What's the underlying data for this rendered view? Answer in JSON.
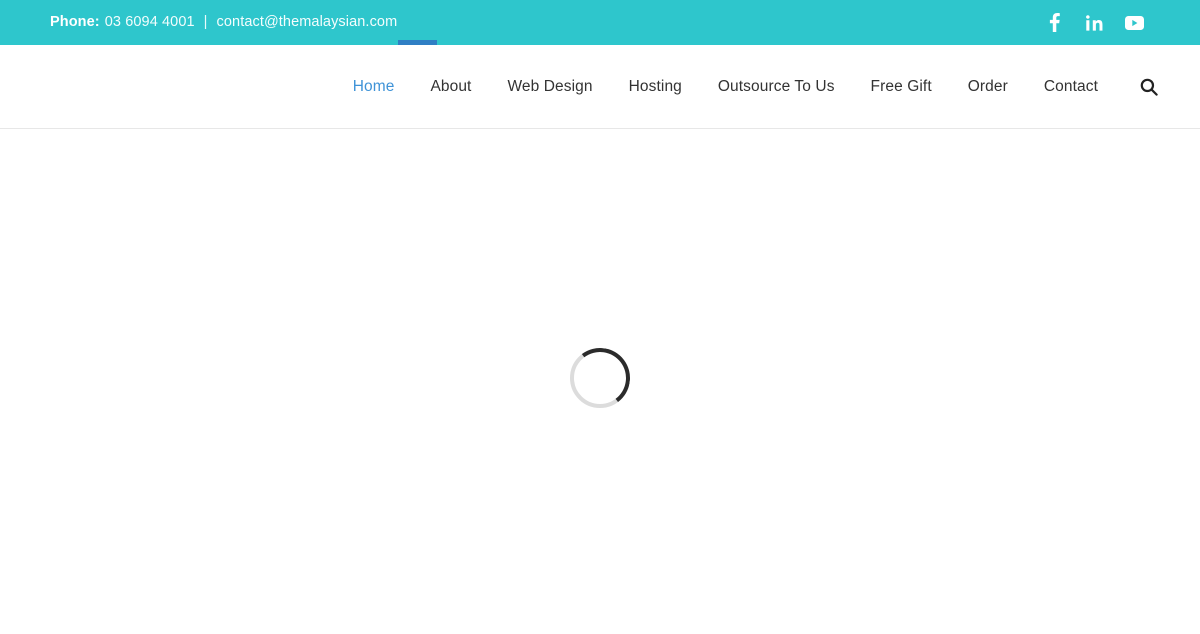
{
  "topbar": {
    "phone_label": "Phone:",
    "phone_number": "03 6094 4001",
    "separator": "|",
    "email": "contact@themalaysian.com",
    "background_color": "#2ec6cc",
    "social": [
      {
        "name": "facebook",
        "icon": "facebook-icon",
        "label": "Facebook"
      },
      {
        "name": "linkedin",
        "icon": "linkedin-icon",
        "label": "LinkedIn"
      },
      {
        "name": "youtube",
        "icon": "youtube-icon",
        "label": "YouTube"
      }
    ]
  },
  "nav": {
    "active_color": "#3f93d7",
    "text_color": "#333333",
    "items": [
      {
        "label": "Home",
        "active": true
      },
      {
        "label": "About",
        "active": false
      },
      {
        "label": "Web Design",
        "active": false
      },
      {
        "label": "Hosting",
        "active": false
      },
      {
        "label": "Outsource To Us",
        "active": false
      },
      {
        "label": "Free Gift",
        "active": false
      },
      {
        "label": "Order",
        "active": false
      },
      {
        "label": "Contact",
        "active": false
      }
    ],
    "search_icon": "search-icon"
  },
  "content": {
    "state": "loading",
    "spinner_track_color": "#dcdcdc",
    "spinner_arc_color": "#2b2b2b"
  }
}
